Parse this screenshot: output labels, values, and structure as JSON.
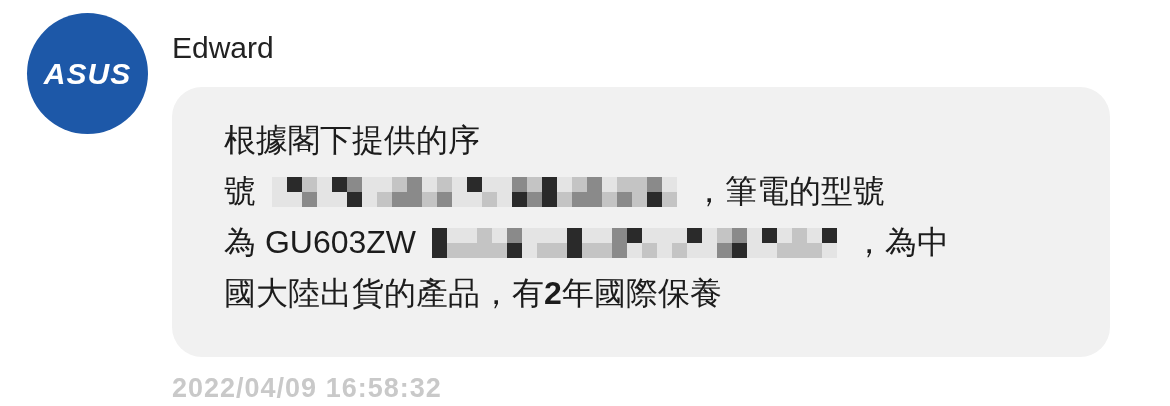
{
  "message": {
    "avatar": {
      "logo_text": "ASUS"
    },
    "sender": "Edward",
    "lines": [
      {
        "segments": [
          {
            "kind": "text",
            "text": "根據閣下提供的序"
          }
        ]
      },
      {
        "segments": [
          {
            "kind": "text",
            "text": "號"
          },
          {
            "kind": "redacted"
          },
          {
            "kind": "text",
            "text": "，筆電的型號"
          }
        ]
      },
      {
        "segments": [
          {
            "kind": "text",
            "text": "為 GU603ZW"
          },
          {
            "kind": "redacted"
          },
          {
            "kind": "text",
            "text": "，為中"
          }
        ]
      },
      {
        "segments": [
          {
            "kind": "text",
            "text": "國大陸出貨的產品，有**2**年國際保養"
          }
        ]
      }
    ],
    "timestamp": "2022/04/09 16:58:32"
  }
}
